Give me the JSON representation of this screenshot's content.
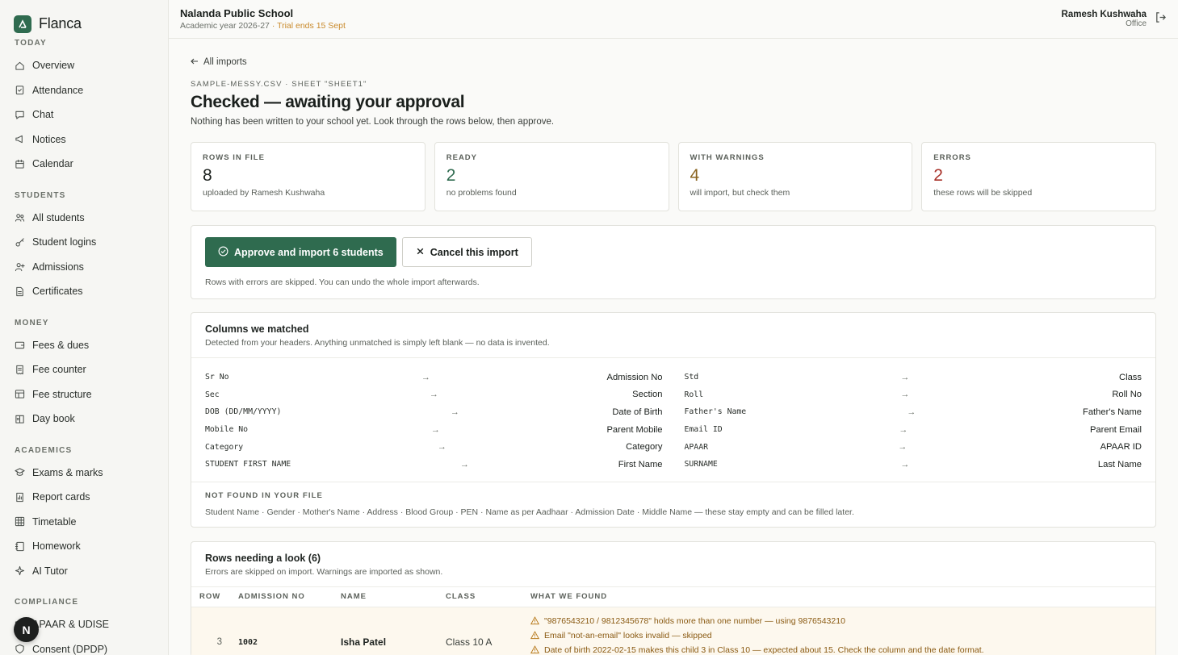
{
  "brand": {
    "name": "Flanca"
  },
  "sidebar": {
    "sections": [
      {
        "title": "TODAY",
        "items": [
          {
            "label": "Overview",
            "icon": "home-icon"
          },
          {
            "label": "Attendance",
            "icon": "clipboard-check-icon"
          },
          {
            "label": "Chat",
            "icon": "chat-icon"
          },
          {
            "label": "Notices",
            "icon": "megaphone-icon"
          },
          {
            "label": "Calendar",
            "icon": "calendar-icon"
          }
        ]
      },
      {
        "title": "STUDENTS",
        "items": [
          {
            "label": "All students",
            "icon": "users-icon"
          },
          {
            "label": "Student logins",
            "icon": "key-icon"
          },
          {
            "label": "Admissions",
            "icon": "user-plus-icon"
          },
          {
            "label": "Certificates",
            "icon": "document-icon"
          }
        ]
      },
      {
        "title": "MONEY",
        "items": [
          {
            "label": "Fees & dues",
            "icon": "wallet-icon"
          },
          {
            "label": "Fee counter",
            "icon": "receipt-icon"
          },
          {
            "label": "Fee structure",
            "icon": "table-icon"
          },
          {
            "label": "Day book",
            "icon": "book-icon"
          }
        ]
      },
      {
        "title": "ACADEMICS",
        "items": [
          {
            "label": "Exams & marks",
            "icon": "graduation-icon"
          },
          {
            "label": "Report cards",
            "icon": "report-icon"
          },
          {
            "label": "Timetable",
            "icon": "grid-icon"
          },
          {
            "label": "Homework",
            "icon": "notebook-icon"
          },
          {
            "label": "AI Tutor",
            "icon": "sparkle-icon"
          }
        ]
      },
      {
        "title": "COMPLIANCE",
        "items": [
          {
            "label": "APAAR & UDISE",
            "icon": "id-card-icon"
          },
          {
            "label": "Consent (DPDP)",
            "icon": "shield-icon"
          }
        ]
      }
    ],
    "avatar_letter": "N"
  },
  "topbar": {
    "school": "Nalanda Public School",
    "academic_year": "Academic year 2026-27",
    "separator": " · ",
    "trial": "Trial ends 15 Sept",
    "user_name": "Ramesh Kushwaha",
    "user_role": "Office"
  },
  "page": {
    "back": "All imports",
    "file_line": "SAMPLE-MESSY.CSV · SHEET \"SHEET1\"",
    "title": "Checked — awaiting your approval",
    "subtitle": "Nothing has been written to your school yet. Look through the rows below, then approve."
  },
  "stats": [
    {
      "label": "ROWS IN FILE",
      "value": "8",
      "desc": "uploaded by Ramesh Kushwaha",
      "color": "#1a1f1c"
    },
    {
      "label": "READY",
      "value": "2",
      "desc": "no problems found",
      "color": "#2f6b4f"
    },
    {
      "label": "WITH WARNINGS",
      "value": "4",
      "desc": "will import, but check them",
      "color": "#8a6420"
    },
    {
      "label": "ERRORS",
      "value": "2",
      "desc": "these rows will be skipped",
      "color": "#a8322a"
    }
  ],
  "actions": {
    "approve": "Approve and import 6 students",
    "cancel": "Cancel this import",
    "note": "Rows with errors are skipped. You can undo the whole import afterwards."
  },
  "columns": {
    "title": "Columns we matched",
    "subtitle": "Detected from your headers. Anything unmatched is simply left blank — no data is invented.",
    "left": [
      {
        "src": "Sr No",
        "dst": "Admission No"
      },
      {
        "src": "Sec",
        "dst": "Section"
      },
      {
        "src": "DOB (DD/MM/YYYY)",
        "dst": "Date of Birth"
      },
      {
        "src": "Mobile No",
        "dst": "Parent Mobile"
      },
      {
        "src": "Category",
        "dst": "Category"
      },
      {
        "src": "STUDENT FIRST NAME",
        "dst": "First Name"
      }
    ],
    "right": [
      {
        "src": "Std",
        "dst": "Class"
      },
      {
        "src": "Roll",
        "dst": "Roll No"
      },
      {
        "src": "Father's Name",
        "dst": "Father's Name"
      },
      {
        "src": "Email ID",
        "dst": "Parent Email"
      },
      {
        "src": "APAAR",
        "dst": "APAAR ID"
      },
      {
        "src": "SURNAME",
        "dst": "Last Name"
      }
    ],
    "arrow": "→",
    "not_found_title": "NOT FOUND IN YOUR FILE",
    "not_found_list": "Student Name · Gender · Mother's Name · Address · Blood Group · PEN · Name as per Aadhaar · Admission Date · Middle Name — these stay empty and can be filled later."
  },
  "rows": {
    "title": "Rows needing a look (6)",
    "subtitle": "Errors are skipped on import. Warnings are imported as shown.",
    "headers": [
      "ROW",
      "ADMISSION NO",
      "NAME",
      "CLASS",
      "WHAT WE FOUND"
    ],
    "items": [
      {
        "row": "3",
        "admission_no": "1002",
        "name": "Isha Patel",
        "class": "Class 10 A",
        "findings": [
          "\"9876543210 / 9812345678\" holds more than one number — using 9876543210",
          "Email \"not-an-email\" looks invalid — skipped",
          "Date of birth 2022-02-15 makes this child 3 in Class 10 — expected about 15. Check the column and the date format."
        ]
      }
    ]
  },
  "colors": {
    "accent": "#2f6b4f",
    "warning": "#8a5a12",
    "error": "#a8322a"
  }
}
